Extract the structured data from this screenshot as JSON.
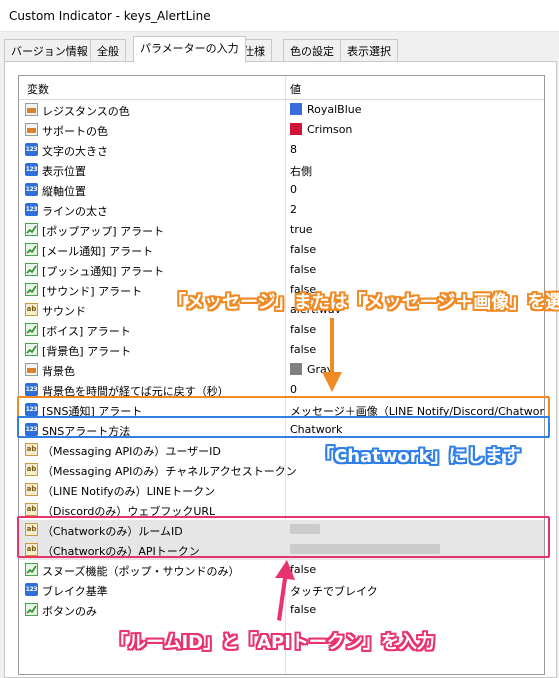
{
  "window": {
    "title": "Custom Indicator - keys_AlertLine"
  },
  "tabs": [
    "バージョン情報",
    "全般",
    "パラメーターの入力",
    "仕様",
    "色の設定",
    "表示選択"
  ],
  "grid": {
    "col_var": "変数",
    "col_val": "値",
    "rows": [
      {
        "icon": "color",
        "name": "レジスタンスの色",
        "value": "RoyalBlue",
        "swatch": "#3a6bdc"
      },
      {
        "icon": "color",
        "name": "サポートの色",
        "value": "Crimson",
        "swatch": "#d2143a"
      },
      {
        "icon": "number",
        "name": "文字の大きさ",
        "value": "8"
      },
      {
        "icon": "number",
        "name": "表示位置",
        "value": "右側"
      },
      {
        "icon": "number",
        "name": "縦軸位置",
        "value": "0"
      },
      {
        "icon": "number",
        "name": "ラインの太さ",
        "value": "2"
      },
      {
        "icon": "bool",
        "name": "[ポップアップ] アラート",
        "value": "true"
      },
      {
        "icon": "bool",
        "name": "[メール通知] アラート",
        "value": "false"
      },
      {
        "icon": "bool",
        "name": "[プッシュ通知] アラート",
        "value": "false"
      },
      {
        "icon": "bool",
        "name": "[サウンド] アラート",
        "value": "false"
      },
      {
        "icon": "string",
        "name": "サウンド",
        "value": "alert.wav"
      },
      {
        "icon": "bool",
        "name": "[ボイス] アラート",
        "value": "false"
      },
      {
        "icon": "bool",
        "name": "[背景色] アラート",
        "value": "false"
      },
      {
        "icon": "color",
        "name": "背景色",
        "value": "Gray",
        "swatch": "#808080"
      },
      {
        "icon": "number",
        "name": "背景色を時間が経てば元に戻す（秒）",
        "value": "0"
      },
      {
        "icon": "number",
        "name": "[SNS通知] アラート",
        "value": "メッセージ＋画像（LINE Notify/Discord/Chatwork..."
      },
      {
        "icon": "number",
        "name": "SNSアラート方法",
        "value": "Chatwork"
      },
      {
        "icon": "string",
        "name": "（Messaging APIのみ）ユーザーID",
        "value": ""
      },
      {
        "icon": "string",
        "name": "（Messaging APIのみ）チャネルアクセストークン",
        "value": ""
      },
      {
        "icon": "string",
        "name": "（LINE Notifyのみ）LINEトークン",
        "value": ""
      },
      {
        "icon": "string",
        "name": "（Discordのみ）ウェブフックURL",
        "value": ""
      },
      {
        "icon": "string",
        "name": "（Chatworkのみ）ルームID",
        "value": "",
        "masked": true
      },
      {
        "icon": "string",
        "name": "（Chatworkのみ）APIトークン",
        "value": "",
        "masked": true
      },
      {
        "icon": "bool",
        "name": "スヌーズ機能（ポップ・サウンドのみ）",
        "value": "false"
      },
      {
        "icon": "number",
        "name": "ブレイク基準",
        "value": "タッチでブレイク"
      },
      {
        "icon": "bool",
        "name": "ボタンのみ",
        "value": "false"
      }
    ]
  },
  "annotations": {
    "orange": "「メッセージ」または「メッセージ＋画像」を選択",
    "blue": "「Chatwork」にします",
    "pink": "「ルームID」と「APIトークン」を入力"
  },
  "colors": {
    "orange": "#f08a24",
    "blue": "#2f7fe6",
    "pink": "#e8336f",
    "selected_row": "#e6e6e6"
  }
}
